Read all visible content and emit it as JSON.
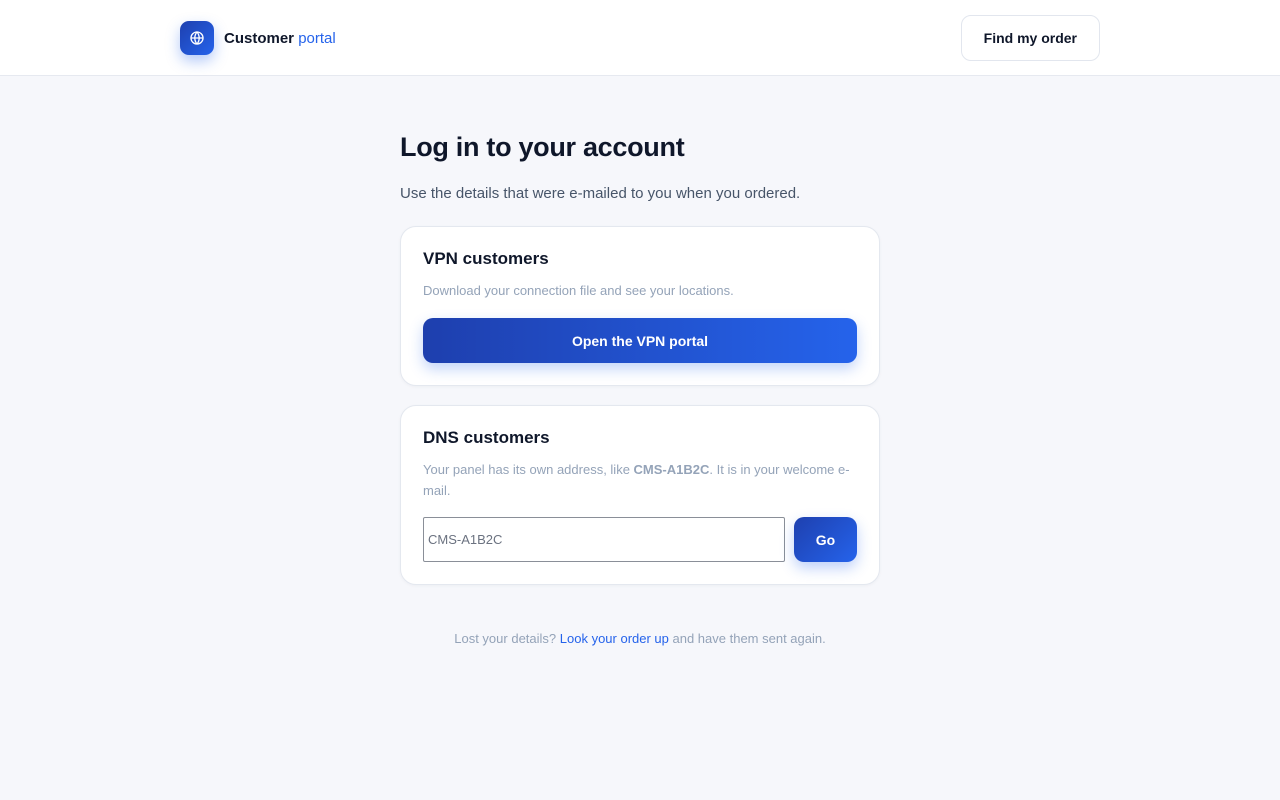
{
  "header": {
    "brand_name": "Customer",
    "brand_accent": "portal",
    "find_order_label": "Find my order"
  },
  "main": {
    "title": "Log in to your account",
    "subtitle": "Use the details that were e-mailed to you when you ordered."
  },
  "vpn_card": {
    "title": "VPN customers",
    "description": "Download your connection file and see your locations.",
    "button_label": "Open the VPN portal"
  },
  "dns_card": {
    "title": "DNS customers",
    "description_before": "Your panel has its own address, like ",
    "description_code": "CMS-A1B2C",
    "description_after": ". It is in your welcome e-mail.",
    "input_value": "",
    "input_placeholder": "CMS-A1B2C",
    "go_label": "Go"
  },
  "footer": {
    "text_before": "Lost your details? ",
    "link_text": "Look your order up",
    "text_after": " and have them sent again."
  },
  "colors": {
    "accent": "#2563eb",
    "accent_dark": "#1e40af",
    "background": "#f6f7fb"
  },
  "icons": {
    "logo": "globe-icon"
  }
}
